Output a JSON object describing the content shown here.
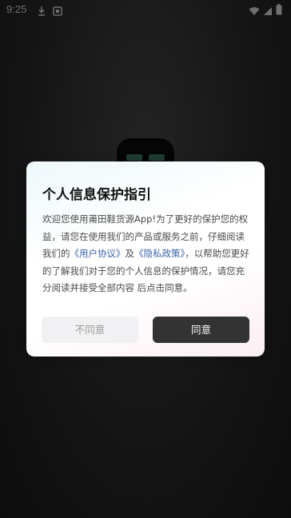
{
  "status_bar": {
    "time": "9:25",
    "icons": [
      "download-icon",
      "notification-icon",
      "wifi-icon",
      "signal-icon",
      "battery-icon"
    ]
  },
  "background_app_icon": {
    "icon": "app-logo"
  },
  "dialog": {
    "title": "个人信息保护指引",
    "body_prefix": "欢迎您使用莆田鞋货源App!为了更好的保护您的权益，请您在使用我们的产品或服务之前，仔细阅读我们的",
    "user_agreement_link": "《用户协议》",
    "and_text": "及",
    "privacy_policy_link": "《隐私政策》",
    "body_suffix": "，以帮助您更好的了解我们对于您的个人信息的保护情况，请您充分阅读并接受全部内容 后点击同意。",
    "link_color": "#3a63a8",
    "disagree_label": "不同意",
    "agree_label": "同意"
  }
}
